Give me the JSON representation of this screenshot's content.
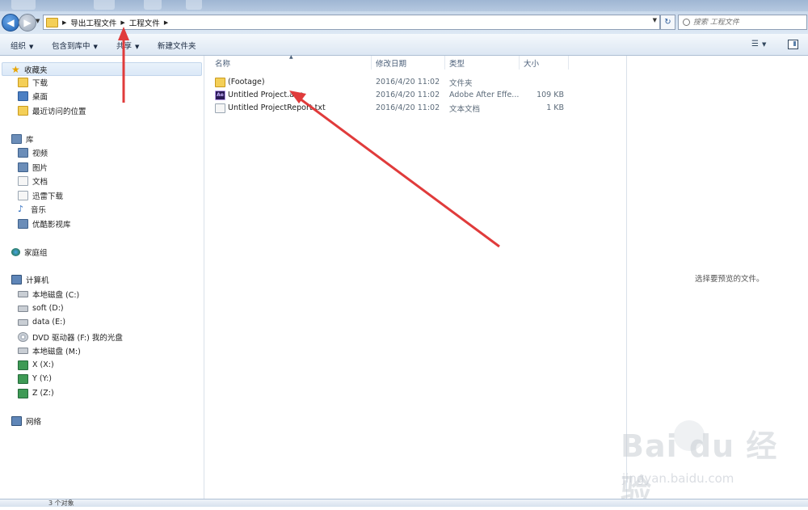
{
  "address_bar": {
    "crumbs": [
      "导出工程文件",
      "工程文件"
    ],
    "search_placeholder": "搜索 工程文件"
  },
  "toolbar": {
    "organize": "组织",
    "include_in_library": "包含到库中",
    "share": "共享",
    "new_folder": "新建文件夹"
  },
  "nav": {
    "favorites_header": "收藏夹",
    "favorites": [
      "下载",
      "桌面",
      "最近访问的位置"
    ],
    "libraries_header": "库",
    "libraries": [
      "视频",
      "图片",
      "文档",
      "迅雷下载",
      "音乐",
      "优酷影视库"
    ],
    "homegroup": "家庭组",
    "computer_header": "计算机",
    "drives": [
      "本地磁盘 (C:)",
      "soft (D:)",
      "data (E:)",
      "DVD 驱动器 (F:) 我的光盘",
      "本地磁盘 (M:)",
      "X (X:)",
      "Y (Y:)",
      "Z (Z:)"
    ],
    "network": "网络"
  },
  "file_list": {
    "columns": [
      "名称",
      "修改日期",
      "类型",
      "大小"
    ],
    "rows": [
      {
        "name": "(Footage)",
        "date": "2016/4/20 11:02",
        "type": "文件夹",
        "size": ""
      },
      {
        "name": "Untitled Project.aep",
        "date": "2016/4/20 11:02",
        "type": "Adobe After Effe...",
        "size": "109 KB"
      },
      {
        "name": "Untitled ProjectReport.txt",
        "date": "2016/4/20 11:02",
        "type": "文本文档",
        "size": "1 KB"
      }
    ]
  },
  "preview": {
    "empty_text": "选择要预览的文件。"
  },
  "status_bar": {
    "text": "3 个对象"
  },
  "watermark": {
    "logo": "Bai du 经验",
    "url": "jingyan.baidu.com"
  },
  "colors": {
    "annotation_arrow": "#e03b3b",
    "accent_blue": "#1b5fb2"
  },
  "icons": {
    "back": "back-arrow-icon",
    "forward": "forward-arrow-icon",
    "refresh": "refresh-icon",
    "search": "search-icon"
  }
}
